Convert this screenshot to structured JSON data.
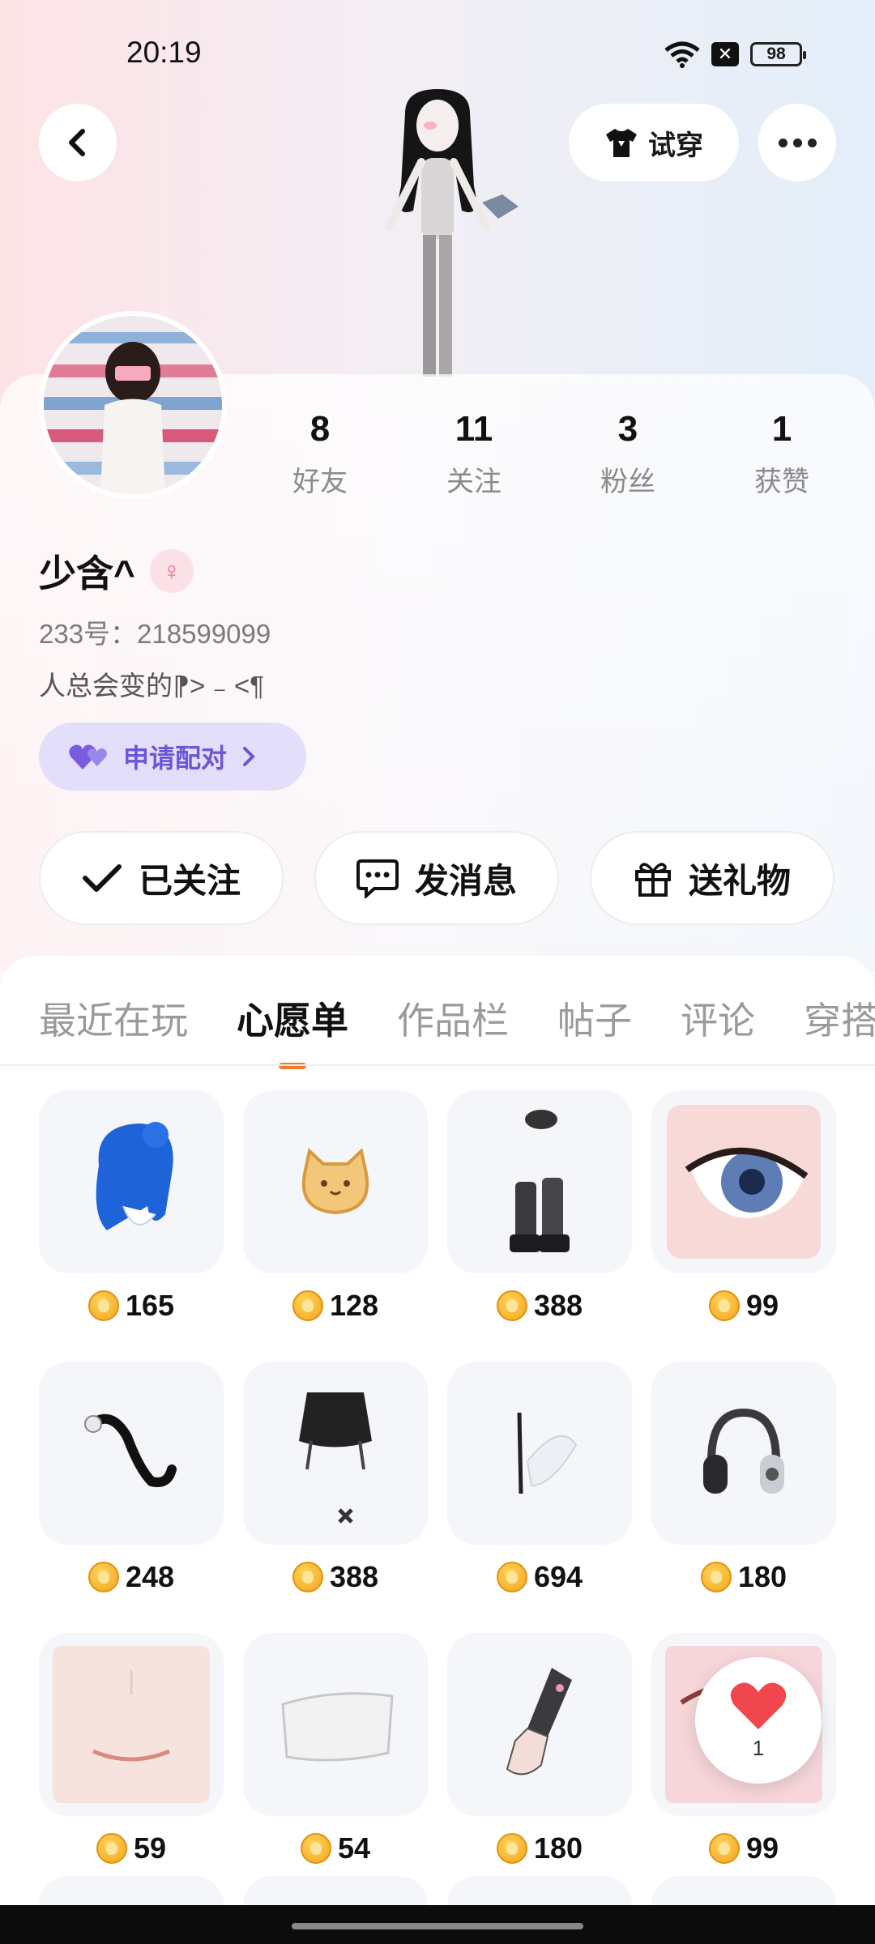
{
  "status_bar": {
    "time": "20:19",
    "battery": "98"
  },
  "header": {
    "tryon_label": "试穿"
  },
  "stats": [
    {
      "value": "8",
      "label": "好友"
    },
    {
      "value": "11",
      "label": "关注"
    },
    {
      "value": "3",
      "label": "粉丝"
    },
    {
      "value": "1",
      "label": "获赞"
    }
  ],
  "profile": {
    "username": "少含^",
    "uid": "233号：218599099",
    "bio": "人总会变的⁋> ₋ <¶",
    "pair_label": "申请配对"
  },
  "actions": {
    "follow_label": "已关注",
    "message_label": "发消息",
    "gift_label": "送礼物"
  },
  "tabs": [
    "最近在玩",
    "心愿单",
    "作品栏",
    "帖子",
    "评论",
    "穿搭"
  ],
  "active_tab": "心愿单",
  "wishlist": [
    {
      "icon": "blue-hair-icon",
      "price": "165"
    },
    {
      "icon": "cat-bread-icon",
      "price": "128"
    },
    {
      "icon": "boots-icon",
      "price": "388"
    },
    {
      "icon": "eye-icon",
      "price": "99"
    },
    {
      "icon": "tail-icon",
      "price": "248"
    },
    {
      "icon": "skirt-icon",
      "price": "388"
    },
    {
      "icon": "wing-icon",
      "price": "694"
    },
    {
      "icon": "headphones-icon",
      "price": "180"
    },
    {
      "icon": "mouth-icon",
      "price": "59"
    },
    {
      "icon": "pillow-icon",
      "price": "54"
    },
    {
      "icon": "glove-icon",
      "price": "180"
    },
    {
      "icon": "eye-makeup-icon",
      "price": "99"
    }
  ],
  "like_float": {
    "count": "1"
  },
  "colors": {
    "accent": "#f47a2a",
    "pair_bg": "#e3defa",
    "pair_text": "#6c56d6",
    "coin": "#f3a51e"
  }
}
